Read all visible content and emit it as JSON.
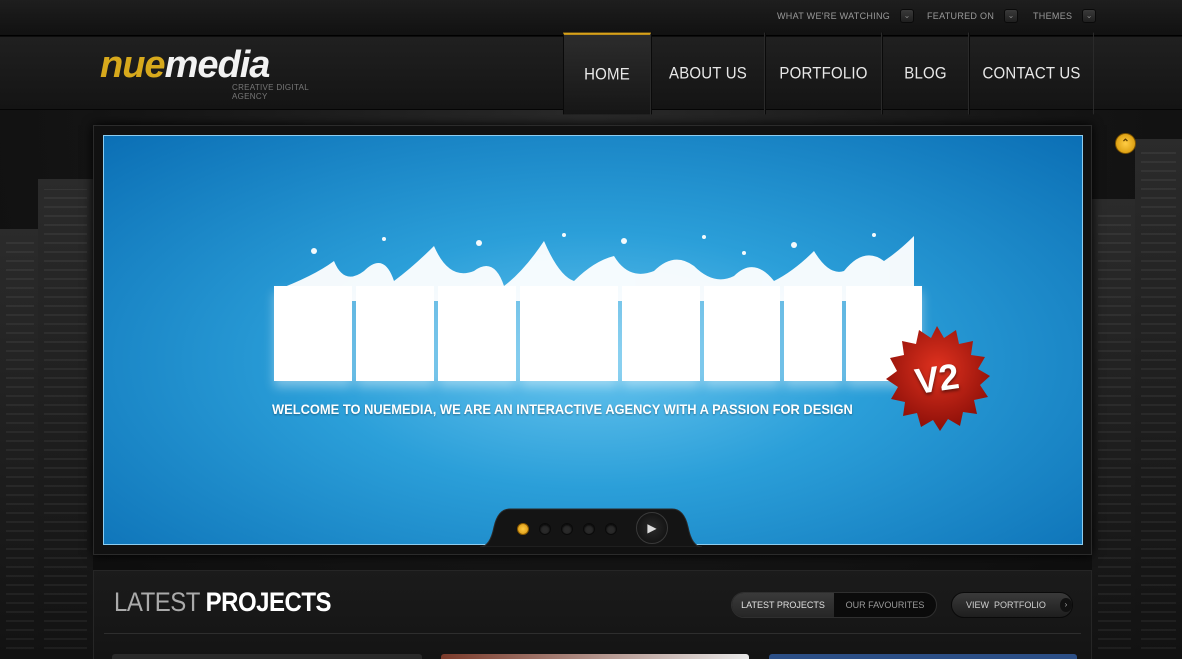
{
  "utility_bar": {
    "items": [
      {
        "label": "WHAT WE'RE WATCHING",
        "icon": "chevron-down-icon"
      },
      {
        "label": "FEATURED ON",
        "icon": "chevron-down-icon"
      },
      {
        "label": "THEMES",
        "icon": "chevron-down-icon"
      }
    ]
  },
  "header": {
    "logo": {
      "part1": "nue",
      "part2": "media",
      "tagline": "CREATIVE DIGITAL AGENCY"
    },
    "nav": [
      {
        "label": "HOME",
        "active": true
      },
      {
        "label": "ABOUT US",
        "active": false
      },
      {
        "label": "PORTFOLIO",
        "active": false
      },
      {
        "label": "BLOG",
        "active": false
      },
      {
        "label": "CONTACT US",
        "active": false
      }
    ]
  },
  "slider": {
    "welcome_text": "WELCOME TO NUEMEDIA, WE ARE AN INTERACTIVE AGENCY WITH A PASSION FOR DESIGN",
    "badge_text": "V2",
    "slide_count": 5,
    "active_slide": 1,
    "next_icon": "play-icon",
    "scroll_top_icon": "chevron-up-icon"
  },
  "projects": {
    "title_light": "LATEST",
    "title_bold": "PROJECTS",
    "tabs": [
      {
        "label": "LATEST PROJECTS",
        "active": true
      },
      {
        "label": "OUR FAVOURITES",
        "active": false
      }
    ],
    "view_button": "VIEW  PORTFOLIO"
  },
  "colors": {
    "accent": "#d7a91c",
    "slide_blue": "#2b9fd9",
    "badge_red": "#b8170e"
  }
}
